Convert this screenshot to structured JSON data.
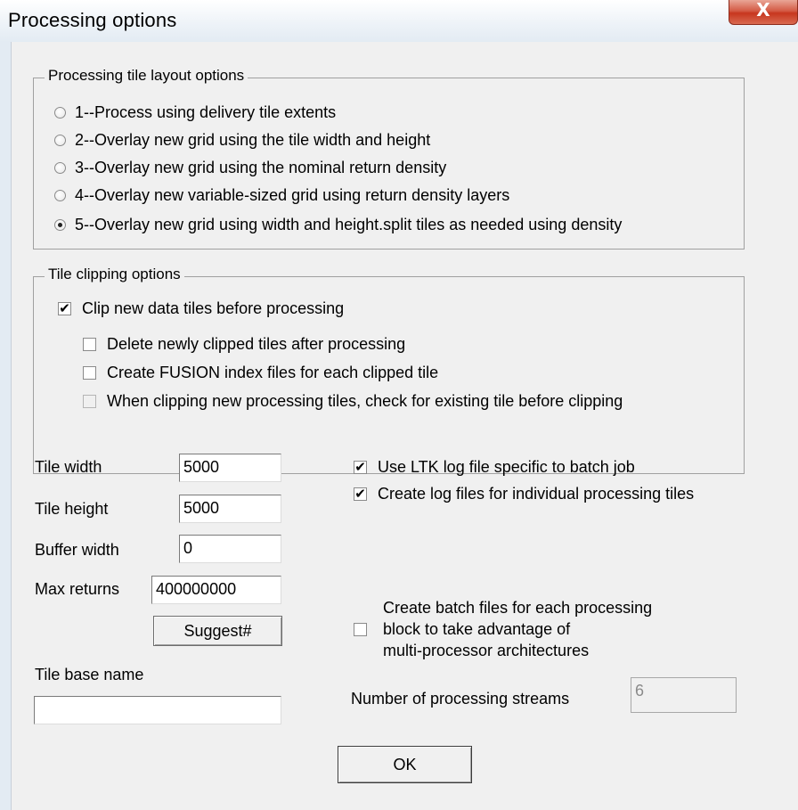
{
  "window": {
    "title": "Processing options",
    "close_glyph": "X"
  },
  "layout_group": {
    "title": "Processing tile layout options",
    "options": [
      {
        "label": "1--Process using delivery tile extents",
        "selected": false
      },
      {
        "label": "2--Overlay new grid using the tile width and height",
        "selected": false
      },
      {
        "label": "3--Overlay new grid using the nominal return density",
        "selected": false
      },
      {
        "label": "4--Overlay new variable-sized grid using return density layers",
        "selected": false
      },
      {
        "label": "5--Overlay new grid using width and height.split tiles as needed using density",
        "selected": true
      }
    ]
  },
  "clip_group": {
    "title": "Tile clipping options",
    "clip_new": {
      "label": "Clip new data tiles before processing",
      "checked": true
    },
    "delete_clipped": {
      "label": "Delete newly clipped tiles after processing",
      "checked": false
    },
    "create_index": {
      "label": "Create FUSION index files for each clipped tile",
      "checked": false
    },
    "check_existing": {
      "label": "When clipping new processing tiles, check for existing tile before clipping",
      "checked": false
    }
  },
  "fields": {
    "tile_width": {
      "label": "Tile width",
      "value": "5000"
    },
    "tile_height": {
      "label": "Tile height",
      "value": "5000"
    },
    "buffer_width": {
      "label": "Buffer width",
      "value": "0"
    },
    "max_returns": {
      "label": "Max returns",
      "value": "400000000"
    },
    "suggest_button": "Suggest#",
    "tile_base_name": {
      "label": "Tile base name",
      "value": ""
    }
  },
  "log_options": {
    "ltk_log": {
      "label": "Use LTK log file specific to batch job",
      "checked": true
    },
    "tile_logs": {
      "label": "Create log files for individual processing tiles",
      "checked": true
    }
  },
  "batch": {
    "label_lines": [
      "Create batch files for each processing",
      "block to take advantage of",
      "multi-processor architectures"
    ],
    "checked": false,
    "streams_label": "Number of processing streams",
    "streams_value": "6"
  },
  "ok_button": "OK"
}
